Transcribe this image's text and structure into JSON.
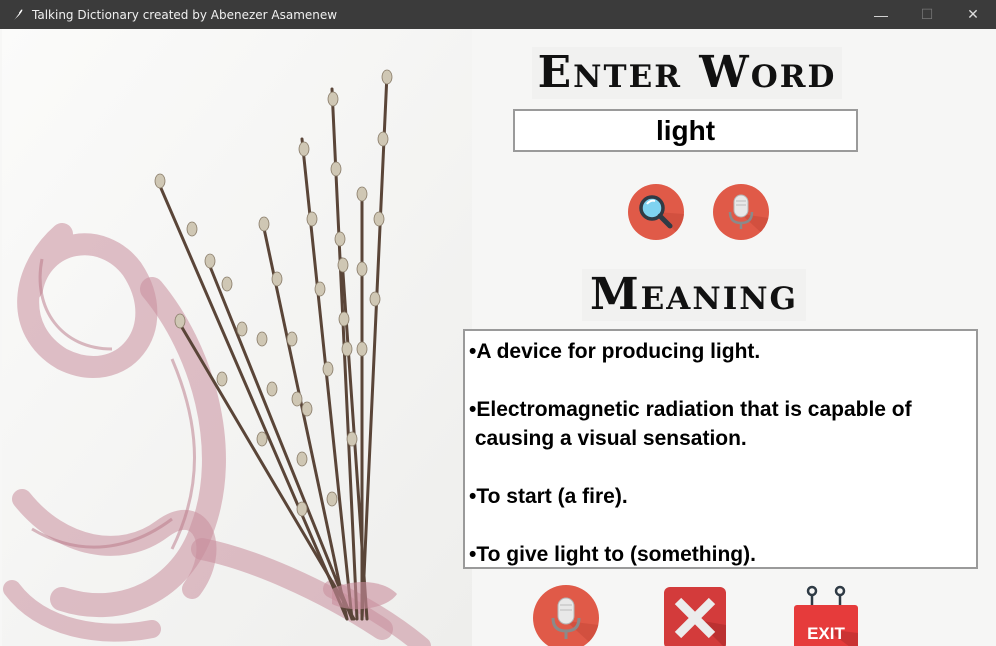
{
  "window": {
    "title": "Talking Dictionary created by Abenezer Asamenew",
    "controls": {
      "minimize": "—",
      "maximize": "☐",
      "close": "✕"
    }
  },
  "main": {
    "enter_heading": "Enter Word",
    "search_input": {
      "value": "light",
      "placeholder": ""
    },
    "meaning_heading": "Meaning",
    "meanings": [
      "•A device for producing light.",
      "",
      "•Electromagnetic radiation that is capable of",
      " causing a visual sensation.",
      "",
      "•To start (a fire).",
      "",
      "•To give light to (something)."
    ]
  },
  "buttons": {
    "search": "magnifier-icon",
    "voice_input": "microphone-icon",
    "speak": "microphone-icon",
    "clear": "close-x-icon",
    "exit": "EXIT"
  },
  "colors": {
    "titlebar": "#3b3b3b",
    "button_red": "#e05a48",
    "clear_red": "#d33b3b",
    "exit_red": "#e63b3b"
  }
}
